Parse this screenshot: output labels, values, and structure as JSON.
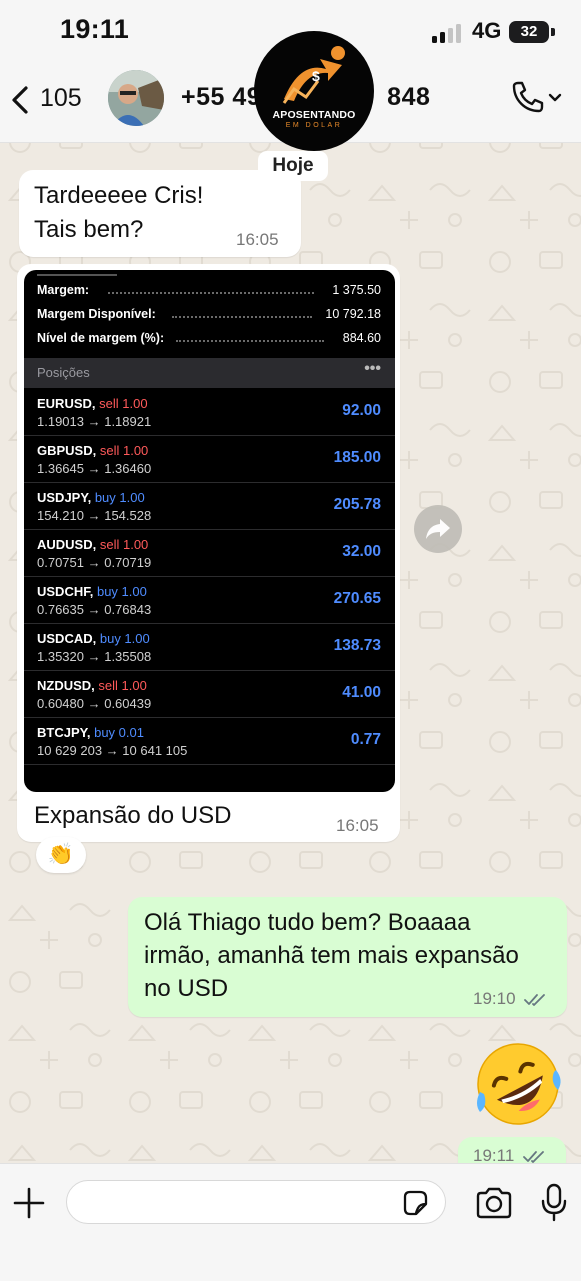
{
  "status_bar": {
    "time": "19:11",
    "network": "4G",
    "battery": "32"
  },
  "header": {
    "back_count": "105",
    "contact_name": "+55 49",
    "contact_name_end": "848"
  },
  "watermark": {
    "line1": "APOSENTANDO",
    "line2": "EM DOLAR"
  },
  "date_divider": "Hoje",
  "messages": {
    "m1": {
      "line1": "Tardeeeee Cris!",
      "line2": "Tais bem?",
      "time": "16:05"
    },
    "m2": {
      "caption": "Expansão do USD",
      "time": "16:05",
      "reaction": "👏"
    },
    "m3": {
      "line1": "Olá Thiago tudo bem? Boaaaa",
      "line2": "irmão, amanhã tem mais expansão",
      "line3": "no USD",
      "time": "19:10"
    },
    "m4": {
      "time": "19:11"
    }
  },
  "trading": {
    "account": [
      {
        "label": "Margem:",
        "value": "1 375.50"
      },
      {
        "label": "Margem Disponível:",
        "value": "10 792.18"
      },
      {
        "label": "Nível de margem (%):",
        "value": "884.60"
      }
    ],
    "positions_title": "Posições",
    "positions_more": "•••",
    "positions": [
      {
        "symbol": "EURUSD,",
        "side": "sell 1.00",
        "prices": "1.19013 → 1.18921",
        "profit": "92.00"
      },
      {
        "symbol": "GBPUSD,",
        "side": "sell 1.00",
        "prices": "1.36645 → 1.36460",
        "profit": "185.00"
      },
      {
        "symbol": "USDJPY,",
        "side": "buy 1.00",
        "prices": "154.210 → 154.528",
        "profit": "205.78"
      },
      {
        "symbol": "AUDUSD,",
        "side": "sell 1.00",
        "prices": "0.70751 → 0.70719",
        "profit": "32.00"
      },
      {
        "symbol": "USDCHF,",
        "side": "buy 1.00",
        "prices": "0.76635 → 0.76843",
        "profit": "270.65"
      },
      {
        "symbol": "USDCAD,",
        "side": "buy 1.00",
        "prices": "1.35320 → 1.35508",
        "profit": "138.73"
      },
      {
        "symbol": "NZDUSD,",
        "side": "sell 1.00",
        "prices": "0.60480 → 0.60439",
        "profit": "41.00"
      },
      {
        "symbol": "BTCJPY,",
        "side": "buy 0.01",
        "prices": "10 629 203 → 10 641 105",
        "profit": "0.77"
      }
    ],
    "colors": {
      "sell": "#ff5a5a",
      "buy": "#4f8cff",
      "profit": "#4f8cff"
    }
  },
  "composer": {
    "placeholder": ""
  },
  "colors": {
    "outgoing_bubble": "#d9fdd3",
    "chat_bg": "#efeae2",
    "read_ticks": "#667781"
  }
}
